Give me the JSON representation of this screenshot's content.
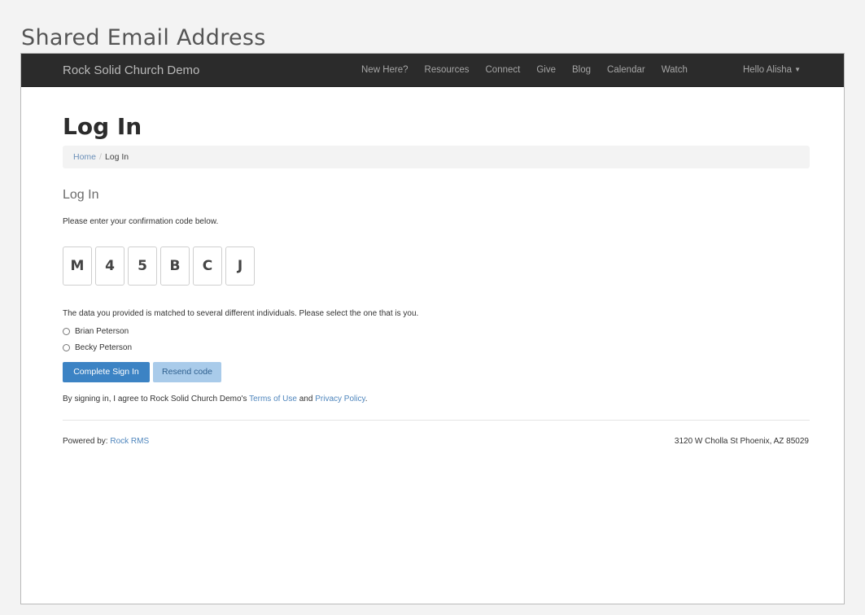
{
  "caption": "Shared Email Address",
  "navbar": {
    "brand": "Rock Solid Church Demo",
    "links": [
      "New Here?",
      "Resources",
      "Connect",
      "Give",
      "Blog",
      "Calendar",
      "Watch"
    ],
    "user_menu": "Hello Alisha",
    "user_menu_icon": "caret-down-icon"
  },
  "page": {
    "title": "Log In",
    "breadcrumb": {
      "home": "Home",
      "separator": "/",
      "current": "Log In"
    }
  },
  "login": {
    "heading": "Log In",
    "instructions": "Please enter your confirmation code below.",
    "code": [
      "M",
      "4",
      "5",
      "B",
      "C",
      "J"
    ],
    "match_note": "The data you provided is matched to several different individuals. Please select the one that is you.",
    "options": [
      "Brian Peterson",
      "Becky Peterson"
    ],
    "complete_button": "Complete Sign In",
    "resend_button": "Resend code",
    "agree_prefix": "By signing in, I agree to Rock Solid Church Demo's ",
    "terms_link": "Terms of Use",
    "agree_and": " and ",
    "privacy_link": "Privacy Policy",
    "agree_suffix": "."
  },
  "footer": {
    "powered_prefix": "Powered by: ",
    "powered_link": "Rock RMS",
    "address": "3120 W Cholla St Phoenix, AZ 85029"
  },
  "colors": {
    "navbar": "#2b2b2b",
    "primary": "#3c83c4",
    "secondary": "#a9cbea",
    "link": "#4f86bd"
  }
}
